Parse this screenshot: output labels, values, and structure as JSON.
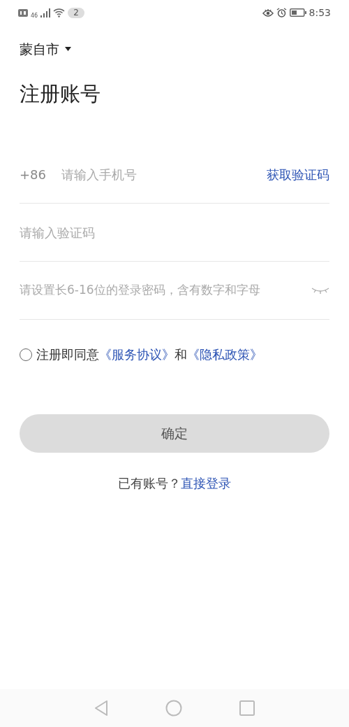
{
  "status_bar": {
    "network": "46",
    "notification_count": "2",
    "time": "8:53"
  },
  "city": "蒙自市",
  "title": "注册账号",
  "phone_field": {
    "prefix": "+86",
    "placeholder": "请输入手机号",
    "action": "获取验证码"
  },
  "code_field": {
    "placeholder": "请输入验证码"
  },
  "password_field": {
    "placeholder": "请设置长6-16位的登录密码，含有数字和字母",
    "visible": false
  },
  "agreement": {
    "checked": false,
    "text": "注册即同意",
    "terms_link": "《服务协议》",
    "conjunction": "和",
    "privacy_link": "《隐私政策》"
  },
  "confirm_button": {
    "label": "确定",
    "disabled": true
  },
  "login_prompt": {
    "text": "已有账号？",
    "link": "直接登录"
  }
}
